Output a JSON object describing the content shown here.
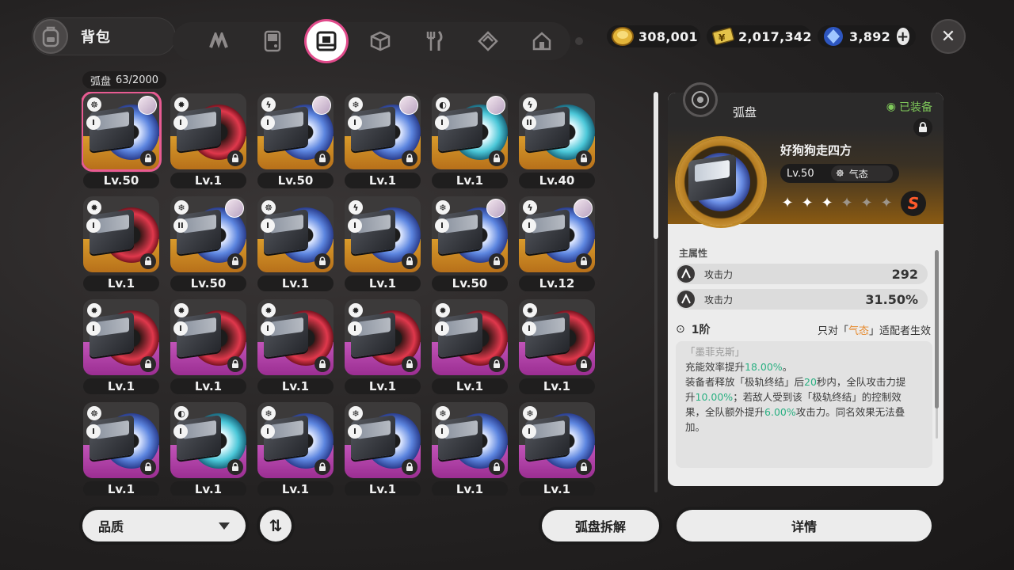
{
  "header": {
    "title": "背包",
    "category_tabs": [
      {
        "name": "drive-tab",
        "icon": "n-logo-icon"
      },
      {
        "name": "gameboy-tab",
        "icon": "gameboy-icon"
      },
      {
        "name": "disc-tab",
        "icon": "disc-icon",
        "active": true
      },
      {
        "name": "box-tab",
        "icon": "cube-icon"
      },
      {
        "name": "food-tab",
        "icon": "fork-knife-icon"
      },
      {
        "name": "material-tab",
        "icon": "diamond-icon"
      },
      {
        "name": "home-tab",
        "icon": "house-icon"
      }
    ],
    "currencies": [
      {
        "name": "gold-coin",
        "value": "308,001",
        "color": "#e3b53a"
      },
      {
        "name": "ticket",
        "value": "2,017,342",
        "color": "#e3c24a"
      },
      {
        "name": "polychrome",
        "value": "3,892",
        "color": "#4d7fe0"
      }
    ]
  },
  "inventory": {
    "category_label": "弧盘",
    "count": "63/2000",
    "items": [
      {
        "attr": "☸",
        "rank": "I",
        "lv": "Lv.50",
        "bg": "gold",
        "disc": "blue",
        "avatar": true,
        "selected": true
      },
      {
        "attr": "✹",
        "rank": "I",
        "lv": "Lv.1",
        "bg": "gold",
        "disc": "red",
        "avatar": false
      },
      {
        "attr": "ϟ",
        "rank": "I",
        "lv": "Lv.50",
        "bg": "gold",
        "disc": "blue",
        "avatar": true
      },
      {
        "attr": "❄",
        "rank": "I",
        "lv": "Lv.1",
        "bg": "gold",
        "disc": "blue",
        "avatar": true
      },
      {
        "attr": "◐",
        "rank": "I",
        "lv": "Lv.1",
        "bg": "gold",
        "disc": "teal",
        "avatar": true
      },
      {
        "attr": "ϟ",
        "rank": "II",
        "lv": "Lv.40",
        "bg": "gold",
        "disc": "teal",
        "avatar": false
      },
      {
        "attr": "✹",
        "rank": "I",
        "lv": "Lv.1",
        "bg": "gold",
        "disc": "red",
        "avatar": false
      },
      {
        "attr": "❄",
        "rank": "II",
        "lv": "Lv.50",
        "bg": "gold",
        "disc": "blue",
        "avatar": true
      },
      {
        "attr": "☸",
        "rank": "I",
        "lv": "Lv.1",
        "bg": "gold",
        "disc": "blue",
        "avatar": false
      },
      {
        "attr": "ϟ",
        "rank": "I",
        "lv": "Lv.1",
        "bg": "gold",
        "disc": "blue",
        "avatar": false
      },
      {
        "attr": "❄",
        "rank": "I",
        "lv": "Lv.50",
        "bg": "gold",
        "disc": "blue",
        "avatar": true
      },
      {
        "attr": "ϟ",
        "rank": "I",
        "lv": "Lv.12",
        "bg": "gold",
        "disc": "blue",
        "avatar": true
      },
      {
        "attr": "✹",
        "rank": "I",
        "lv": "Lv.1",
        "bg": "pink",
        "disc": "red",
        "avatar": false
      },
      {
        "attr": "✹",
        "rank": "I",
        "lv": "Lv.1",
        "bg": "pink",
        "disc": "red",
        "avatar": false
      },
      {
        "attr": "✹",
        "rank": "I",
        "lv": "Lv.1",
        "bg": "pink",
        "disc": "red",
        "avatar": false
      },
      {
        "attr": "✹",
        "rank": "I",
        "lv": "Lv.1",
        "bg": "pink",
        "disc": "red",
        "avatar": false
      },
      {
        "attr": "✹",
        "rank": "I",
        "lv": "Lv.1",
        "bg": "pink",
        "disc": "red",
        "avatar": false
      },
      {
        "attr": "✹",
        "rank": "I",
        "lv": "Lv.1",
        "bg": "pink",
        "disc": "red",
        "avatar": false
      },
      {
        "attr": "☸",
        "rank": "I",
        "lv": "Lv.1",
        "bg": "pink",
        "disc": "blue",
        "avatar": false
      },
      {
        "attr": "◐",
        "rank": "I",
        "lv": "Lv.1",
        "bg": "pink",
        "disc": "teal",
        "avatar": false
      },
      {
        "attr": "❄",
        "rank": "I",
        "lv": "Lv.1",
        "bg": "pink",
        "disc": "blue",
        "avatar": false
      },
      {
        "attr": "❄",
        "rank": "I",
        "lv": "Lv.1",
        "bg": "pink",
        "disc": "blue",
        "avatar": false
      },
      {
        "attr": "❄",
        "rank": "I",
        "lv": "Lv.1",
        "bg": "pink",
        "disc": "blue",
        "avatar": false
      },
      {
        "attr": "❄",
        "rank": "I",
        "lv": "Lv.1",
        "bg": "pink",
        "disc": "blue",
        "avatar": false
      }
    ]
  },
  "detail": {
    "type": "弧盘",
    "equipped": "已装备",
    "name": "好狗狗走四方",
    "level": "Lv.50",
    "attribute": "气态",
    "stars_total": 6,
    "stars_on": 3,
    "grade": "S",
    "main_stats_title": "主属性",
    "stats": [
      {
        "name": "攻击力",
        "value": "292"
      },
      {
        "name": "攻击力",
        "value": "31.50%"
      }
    ],
    "tier": "1阶",
    "condition_prefix": "只对「",
    "condition_attr": "气态",
    "condition_suffix": "」适配者生效",
    "effect_quote": "「墨菲克斯」",
    "effect_l1a": "充能效率提升",
    "effect_l1b": "18.00%",
    "effect_l1c": "。",
    "effect_l2a": "装备者释放「极轨终结」后",
    "effect_l2b": "20",
    "effect_l2c": "秒内，全队攻击力提",
    "effect_l3a": "升",
    "effect_l3b": "10.00%",
    "effect_l3c": "；若敌人受到该「极轨终结」的控制效",
    "effect_l4a": "果，全队额外提升",
    "effect_l4b": "6.00%",
    "effect_l4c": "攻击力。同名效果无法叠",
    "effect_l5": "加。"
  },
  "footer": {
    "sort_label": "品质",
    "dismantle_label": "弧盘拆解",
    "details_label": "详情"
  }
}
